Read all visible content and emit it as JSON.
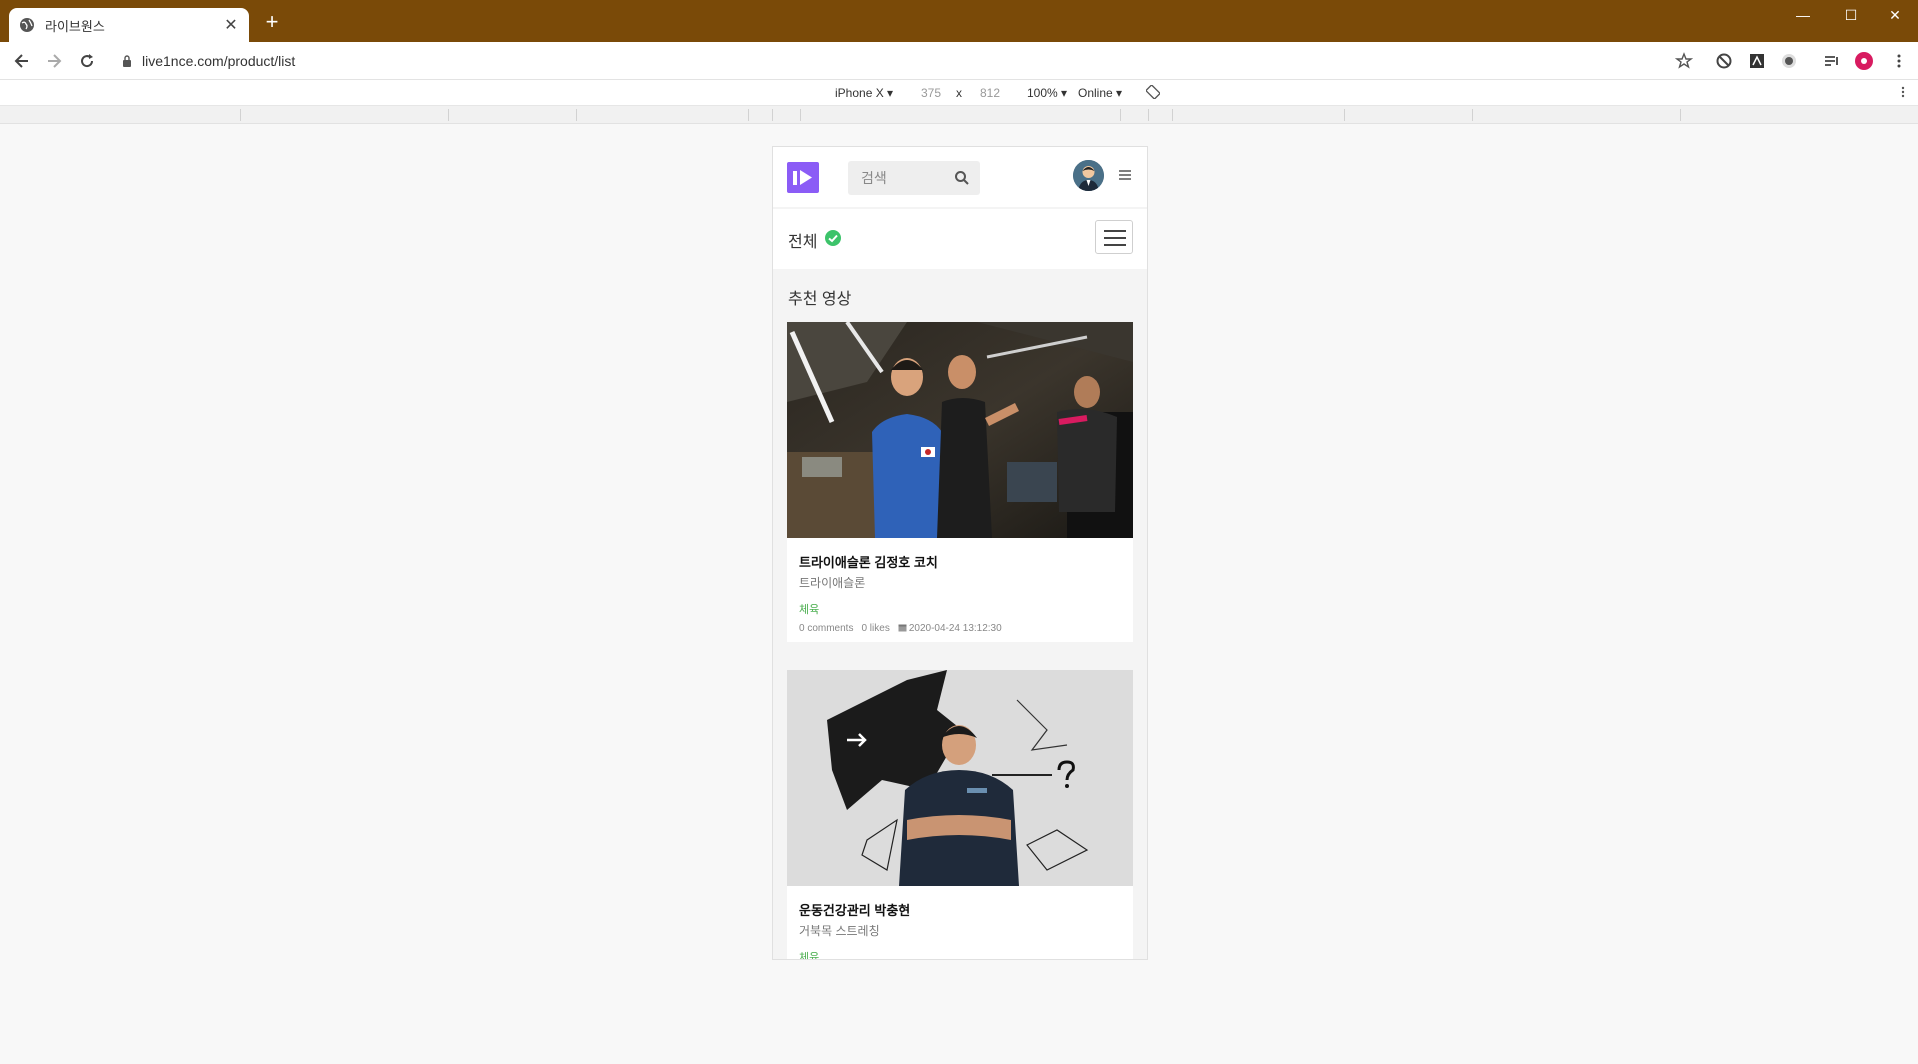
{
  "browser": {
    "tab_title": "라이브원스",
    "tab_close": "✕",
    "new_tab": "+",
    "url": "live1nce.com/product/list",
    "window_controls": {
      "minimize": "—",
      "maximize": "☐",
      "close": "✕"
    },
    "nav_icons": [
      "back-icon",
      "forward-icon",
      "reload-icon"
    ],
    "extension_icons": [
      "star-icon",
      "block-icon",
      "app-icon",
      "shield-icon",
      "playlist-icon",
      "profile-icon",
      "kebab-icon"
    ]
  },
  "devtools": {
    "device": "iPhone X",
    "width": "375",
    "times": "x",
    "height": "812",
    "zoom": "100%",
    "network": "Online",
    "rotate_icon": "rotate-icon"
  },
  "page": {
    "search_placeholder": "검색",
    "category": "전체",
    "section_title": "추천 영상",
    "cards": [
      {
        "title": "트라이애슬론 김정호 코치",
        "subtitle": "트라이애슬론",
        "tag": "체육",
        "comments": "0 comments",
        "likes": "0 likes",
        "date": "2020-04-24 13:12:30"
      },
      {
        "title": "운동건강관리 박충현",
        "subtitle": "거북목 스트레칭",
        "tag": "체육"
      }
    ]
  },
  "colors": {
    "titlebar": "#7a4a08",
    "logo": "#8b5cf6",
    "accent_green": "#4caf50"
  }
}
